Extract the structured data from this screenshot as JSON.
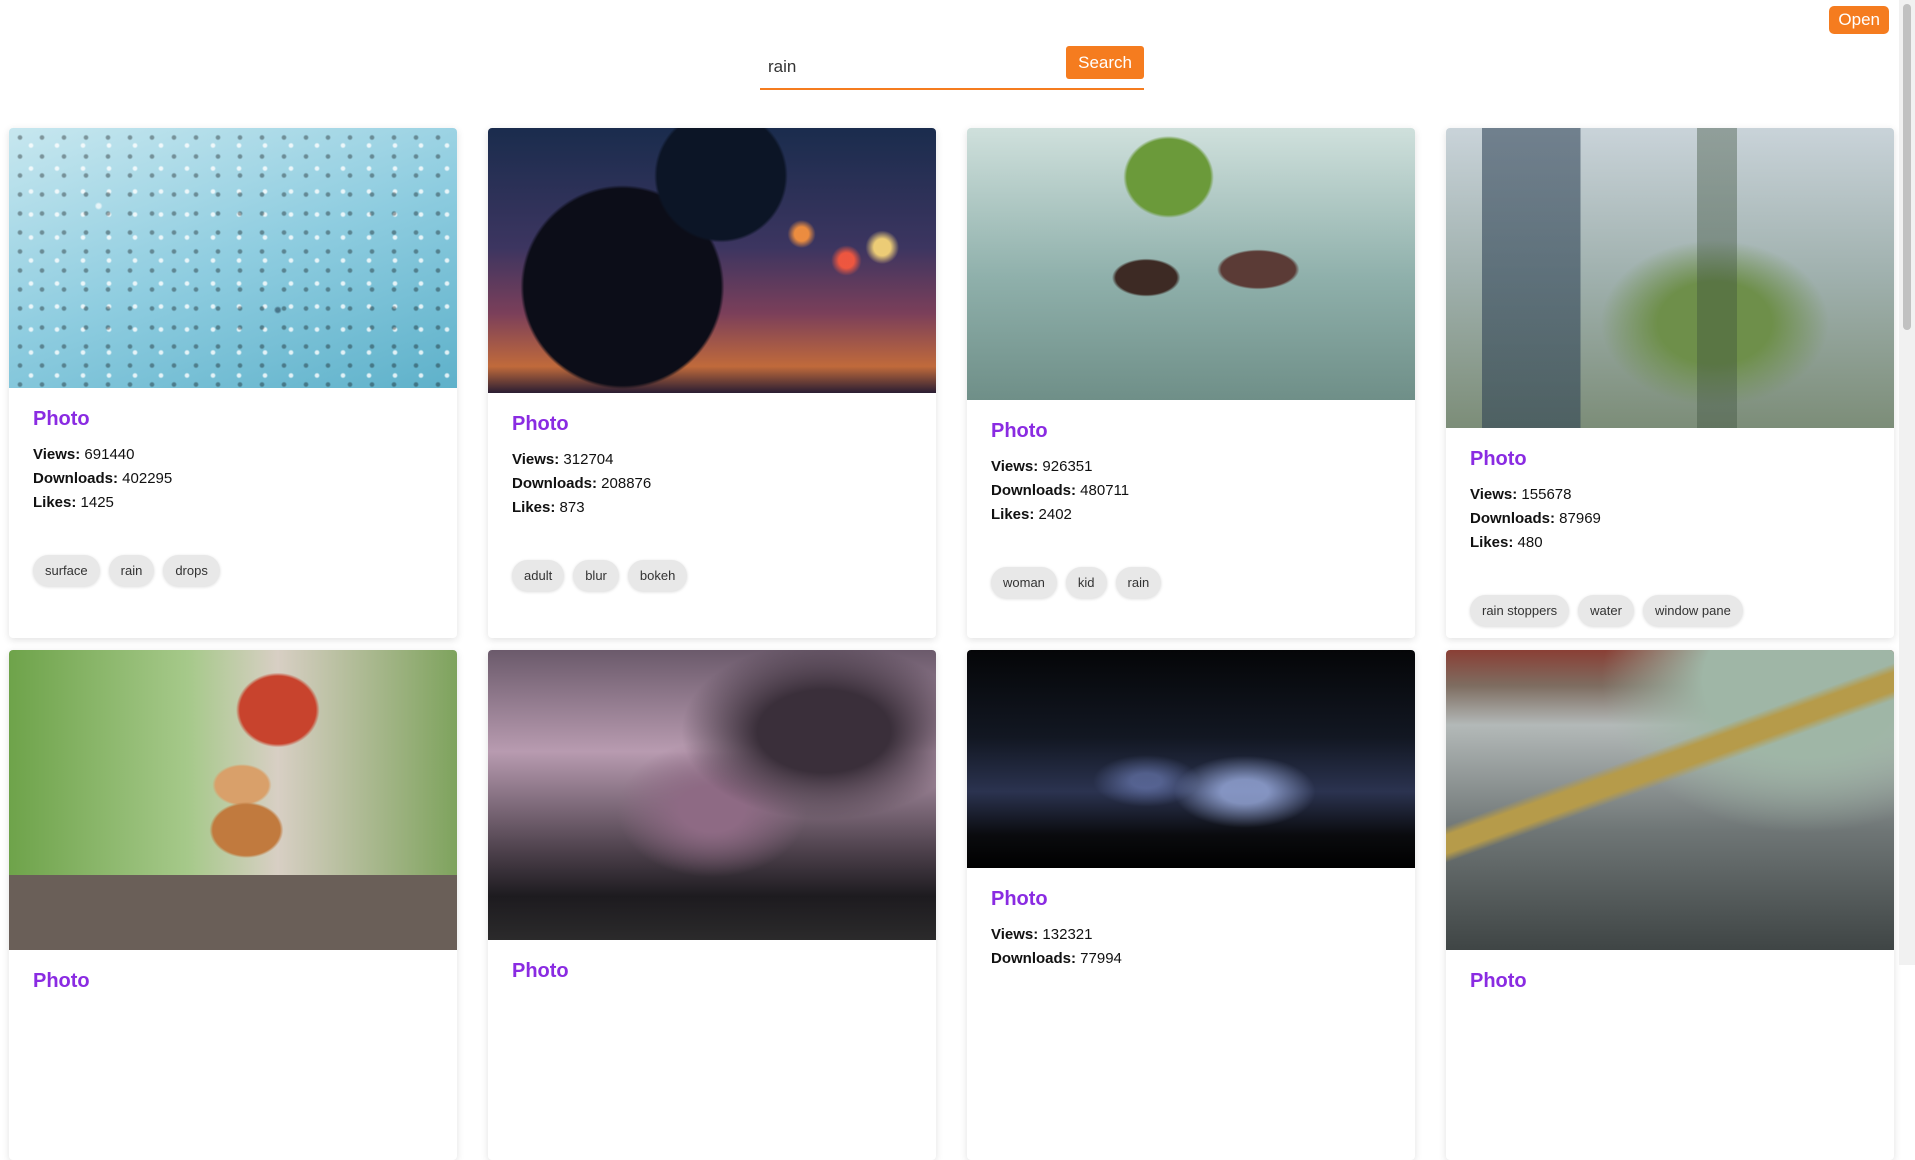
{
  "header": {
    "open_label": "Open"
  },
  "search": {
    "value": "rain",
    "button_label": "Search"
  },
  "photos": [
    {
      "title": "Photo",
      "views_label": "Views:",
      "views": "691440",
      "downloads_label": "Downloads:",
      "downloads": "402295",
      "likes_label": "Likes:",
      "likes": "1425",
      "tags": [
        "surface",
        "rain",
        "drops"
      ]
    },
    {
      "title": "Photo",
      "views_label": "Views:",
      "views": "312704",
      "downloads_label": "Downloads:",
      "downloads": "208876",
      "likes_label": "Likes:",
      "likes": "873",
      "tags": [
        "adult",
        "blur",
        "bokeh"
      ]
    },
    {
      "title": "Photo",
      "views_label": "Views:",
      "views": "926351",
      "downloads_label": "Downloads:",
      "downloads": "480711",
      "likes_label": "Likes:",
      "likes": "2402",
      "tags": [
        "woman",
        "kid",
        "rain"
      ]
    },
    {
      "title": "Photo",
      "views_label": "Views:",
      "views": "155678",
      "downloads_label": "Downloads:",
      "downloads": "87969",
      "likes_label": "Likes:",
      "likes": "480",
      "tags": [
        "rain stoppers",
        "water",
        "window pane"
      ]
    },
    {
      "title": "Photo"
    },
    {
      "title": "Photo"
    },
    {
      "title": "Photo",
      "views_label": "Views:",
      "views": "132321",
      "downloads_label": "Downloads:",
      "downloads": "77994"
    },
    {
      "title": "Photo"
    }
  ]
}
